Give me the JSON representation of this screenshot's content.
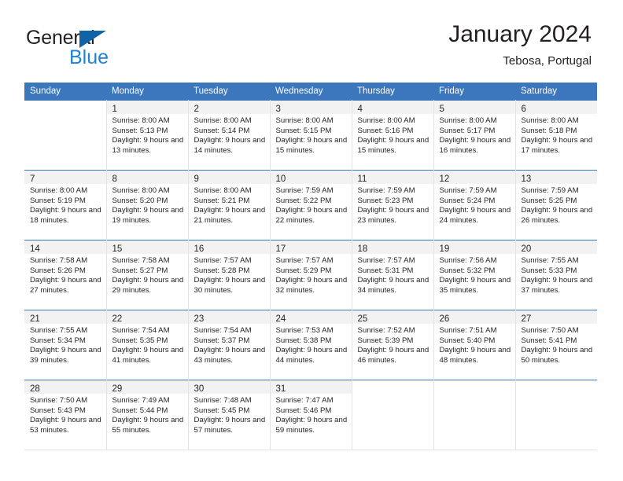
{
  "brand": {
    "name_part1": "General",
    "name_part2": "Blue",
    "triangle_color": "#1063a6",
    "blue_color": "#1e83d2"
  },
  "header": {
    "title": "January 2024",
    "location": "Tebosa, Portugal",
    "header_bg": "#3c77be",
    "day_band_bg": "#f2f2f2"
  },
  "weekdays": [
    "Sunday",
    "Monday",
    "Tuesday",
    "Wednesday",
    "Thursday",
    "Friday",
    "Saturday"
  ],
  "labels": {
    "sunrise": "Sunrise:",
    "sunset": "Sunset:",
    "daylight": "Daylight:"
  },
  "weeks": [
    [
      {
        "num": "",
        "empty": true
      },
      {
        "num": "1",
        "sunrise": "Sunrise: 8:00 AM",
        "sunset": "Sunset: 5:13 PM",
        "daylight": "Daylight: 9 hours and 13 minutes."
      },
      {
        "num": "2",
        "sunrise": "Sunrise: 8:00 AM",
        "sunset": "Sunset: 5:14 PM",
        "daylight": "Daylight: 9 hours and 14 minutes."
      },
      {
        "num": "3",
        "sunrise": "Sunrise: 8:00 AM",
        "sunset": "Sunset: 5:15 PM",
        "daylight": "Daylight: 9 hours and 15 minutes."
      },
      {
        "num": "4",
        "sunrise": "Sunrise: 8:00 AM",
        "sunset": "Sunset: 5:16 PM",
        "daylight": "Daylight: 9 hours and 15 minutes."
      },
      {
        "num": "5",
        "sunrise": "Sunrise: 8:00 AM",
        "sunset": "Sunset: 5:17 PM",
        "daylight": "Daylight: 9 hours and 16 minutes."
      },
      {
        "num": "6",
        "sunrise": "Sunrise: 8:00 AM",
        "sunset": "Sunset: 5:18 PM",
        "daylight": "Daylight: 9 hours and 17 minutes."
      }
    ],
    [
      {
        "num": "7",
        "sunrise": "Sunrise: 8:00 AM",
        "sunset": "Sunset: 5:19 PM",
        "daylight": "Daylight: 9 hours and 18 minutes."
      },
      {
        "num": "8",
        "sunrise": "Sunrise: 8:00 AM",
        "sunset": "Sunset: 5:20 PM",
        "daylight": "Daylight: 9 hours and 19 minutes."
      },
      {
        "num": "9",
        "sunrise": "Sunrise: 8:00 AM",
        "sunset": "Sunset: 5:21 PM",
        "daylight": "Daylight: 9 hours and 21 minutes."
      },
      {
        "num": "10",
        "sunrise": "Sunrise: 7:59 AM",
        "sunset": "Sunset: 5:22 PM",
        "daylight": "Daylight: 9 hours and 22 minutes."
      },
      {
        "num": "11",
        "sunrise": "Sunrise: 7:59 AM",
        "sunset": "Sunset: 5:23 PM",
        "daylight": "Daylight: 9 hours and 23 minutes."
      },
      {
        "num": "12",
        "sunrise": "Sunrise: 7:59 AM",
        "sunset": "Sunset: 5:24 PM",
        "daylight": "Daylight: 9 hours and 24 minutes."
      },
      {
        "num": "13",
        "sunrise": "Sunrise: 7:59 AM",
        "sunset": "Sunset: 5:25 PM",
        "daylight": "Daylight: 9 hours and 26 minutes."
      }
    ],
    [
      {
        "num": "14",
        "sunrise": "Sunrise: 7:58 AM",
        "sunset": "Sunset: 5:26 PM",
        "daylight": "Daylight: 9 hours and 27 minutes."
      },
      {
        "num": "15",
        "sunrise": "Sunrise: 7:58 AM",
        "sunset": "Sunset: 5:27 PM",
        "daylight": "Daylight: 9 hours and 29 minutes."
      },
      {
        "num": "16",
        "sunrise": "Sunrise: 7:57 AM",
        "sunset": "Sunset: 5:28 PM",
        "daylight": "Daylight: 9 hours and 30 minutes."
      },
      {
        "num": "17",
        "sunrise": "Sunrise: 7:57 AM",
        "sunset": "Sunset: 5:29 PM",
        "daylight": "Daylight: 9 hours and 32 minutes."
      },
      {
        "num": "18",
        "sunrise": "Sunrise: 7:57 AM",
        "sunset": "Sunset: 5:31 PM",
        "daylight": "Daylight: 9 hours and 34 minutes."
      },
      {
        "num": "19",
        "sunrise": "Sunrise: 7:56 AM",
        "sunset": "Sunset: 5:32 PM",
        "daylight": "Daylight: 9 hours and 35 minutes."
      },
      {
        "num": "20",
        "sunrise": "Sunrise: 7:55 AM",
        "sunset": "Sunset: 5:33 PM",
        "daylight": "Daylight: 9 hours and 37 minutes."
      }
    ],
    [
      {
        "num": "21",
        "sunrise": "Sunrise: 7:55 AM",
        "sunset": "Sunset: 5:34 PM",
        "daylight": "Daylight: 9 hours and 39 minutes."
      },
      {
        "num": "22",
        "sunrise": "Sunrise: 7:54 AM",
        "sunset": "Sunset: 5:35 PM",
        "daylight": "Daylight: 9 hours and 41 minutes."
      },
      {
        "num": "23",
        "sunrise": "Sunrise: 7:54 AM",
        "sunset": "Sunset: 5:37 PM",
        "daylight": "Daylight: 9 hours and 43 minutes."
      },
      {
        "num": "24",
        "sunrise": "Sunrise: 7:53 AM",
        "sunset": "Sunset: 5:38 PM",
        "daylight": "Daylight: 9 hours and 44 minutes."
      },
      {
        "num": "25",
        "sunrise": "Sunrise: 7:52 AM",
        "sunset": "Sunset: 5:39 PM",
        "daylight": "Daylight: 9 hours and 46 minutes."
      },
      {
        "num": "26",
        "sunrise": "Sunrise: 7:51 AM",
        "sunset": "Sunset: 5:40 PM",
        "daylight": "Daylight: 9 hours and 48 minutes."
      },
      {
        "num": "27",
        "sunrise": "Sunrise: 7:50 AM",
        "sunset": "Sunset: 5:41 PM",
        "daylight": "Daylight: 9 hours and 50 minutes."
      }
    ],
    [
      {
        "num": "28",
        "sunrise": "Sunrise: 7:50 AM",
        "sunset": "Sunset: 5:43 PM",
        "daylight": "Daylight: 9 hours and 53 minutes."
      },
      {
        "num": "29",
        "sunrise": "Sunrise: 7:49 AM",
        "sunset": "Sunset: 5:44 PM",
        "daylight": "Daylight: 9 hours and 55 minutes."
      },
      {
        "num": "30",
        "sunrise": "Sunrise: 7:48 AM",
        "sunset": "Sunset: 5:45 PM",
        "daylight": "Daylight: 9 hours and 57 minutes."
      },
      {
        "num": "31",
        "sunrise": "Sunrise: 7:47 AM",
        "sunset": "Sunset: 5:46 PM",
        "daylight": "Daylight: 9 hours and 59 minutes."
      },
      {
        "num": "",
        "empty": true
      },
      {
        "num": "",
        "empty": true
      },
      {
        "num": "",
        "empty": true
      }
    ]
  ]
}
